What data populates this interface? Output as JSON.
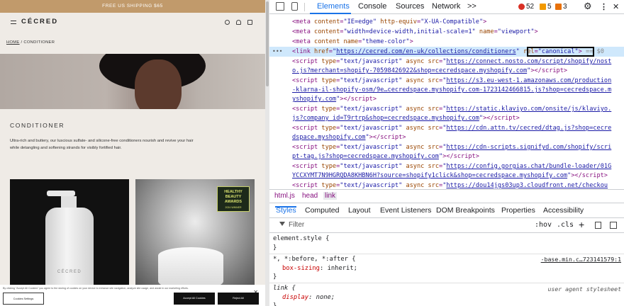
{
  "site": {
    "promo": "FREE US SHIPPING $65",
    "logo": "CÉCRED",
    "breadcrumb_home": "HOME",
    "breadcrumb_sep": " / ",
    "breadcrumb_current": "CONDITIONER",
    "collection_title": "CONDITIONER",
    "collection_desc": "Ultra-rich and buttery, our luscious sulfate- and silicone-free conditioners nourish and revive your hair while detangling and softening strands for visibly fortified hair.",
    "product1_label": "CÉCRED",
    "award_line1": "HEALTHY",
    "award_line2": "BEAUTY",
    "award_line3": "AWARDS",
    "award_small": "2024 WINNER",
    "cookie_text": "By clicking \"Accept All Cookies\" you agree to the storing of cookies on your device to enhance site navigation, analyze site usage, and assist in our marketing efforts.",
    "cookie_settings": "Cookies Settings",
    "cookie_accept": "Accept All Cookies",
    "cookie_reject": "Reject All"
  },
  "devtools": {
    "tabs": [
      "Elements",
      "Console",
      "Sources",
      "Network"
    ],
    "more": ">>",
    "errors": "52",
    "warnings": "5",
    "issues": "3",
    "breadcrumbs": [
      "html.js",
      "head",
      "link"
    ],
    "subtabs": [
      "Styles",
      "Computed",
      "Layout",
      "Event Listeners",
      "DOM Breakpoints",
      "Properties",
      "Accessibility"
    ],
    "filter_placeholder": "Filter",
    "hov": ":hov",
    "cls": ".cls",
    "selected_marker": "== $0"
  },
  "styles": {
    "rule1_selector": "element.style {",
    "rule1_close": "}",
    "rule2_selector": "*, *:before, *:after {",
    "rule2_prop": "box-sizing",
    "rule2_val": "inherit;",
    "rule2_source": "-base.min.c…723141579:1",
    "rule2_close": "}",
    "rule3_selector": "link {",
    "rule3_prop": "display",
    "rule3_val": "none;",
    "rule3_source": "user agent stylesheet",
    "rule3_close": "}"
  }
}
